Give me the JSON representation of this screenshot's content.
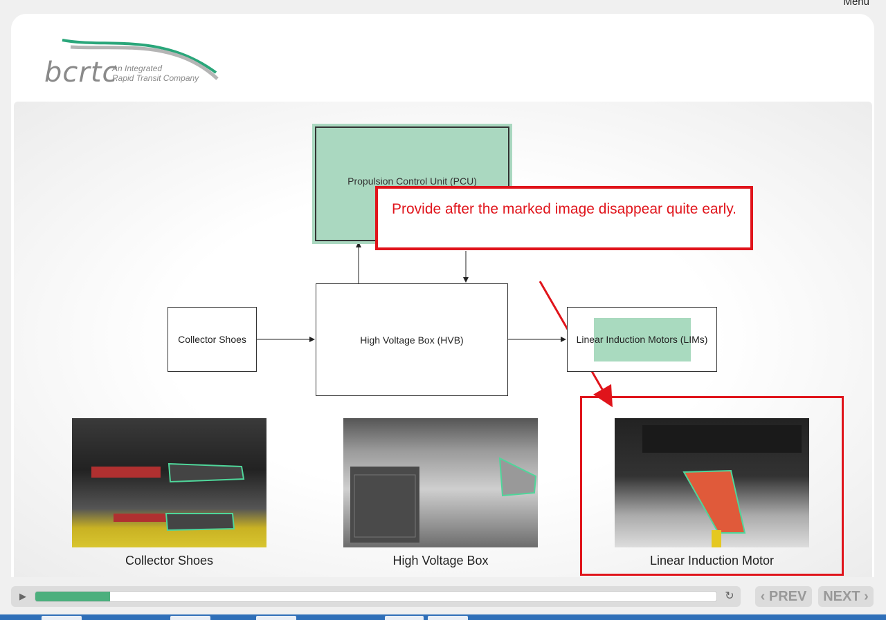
{
  "header": {
    "menu_label": "Menu"
  },
  "logo": {
    "name": "bcrtc",
    "tagline_line1": "An Integrated",
    "tagline_line2": "Rapid Transit Company"
  },
  "diagram": {
    "pcu_label": "Propulsion Control Unit (PCU)",
    "hvb_label": "High Voltage Box (HVB)",
    "collector_label": "Collector Shoes",
    "lim_label": "Linear Induction Motors (LIMs)"
  },
  "callout": {
    "text": "Provide after the marked image disappear quite early."
  },
  "photos": [
    {
      "caption": "Collector Shoes"
    },
    {
      "caption": "High Voltage Box"
    },
    {
      "caption": "Linear Induction Motor"
    }
  ],
  "player": {
    "progress_fraction": 0.11,
    "play_icon": "play-icon",
    "replay_icon": "replay-icon"
  },
  "nav": {
    "prev_label": "‹ PREV",
    "next_label": "NEXT ›"
  },
  "colors": {
    "accent_green": "#4caf7d",
    "highlight_green": "#aad8c0",
    "annotation_red": "#e0141b"
  }
}
